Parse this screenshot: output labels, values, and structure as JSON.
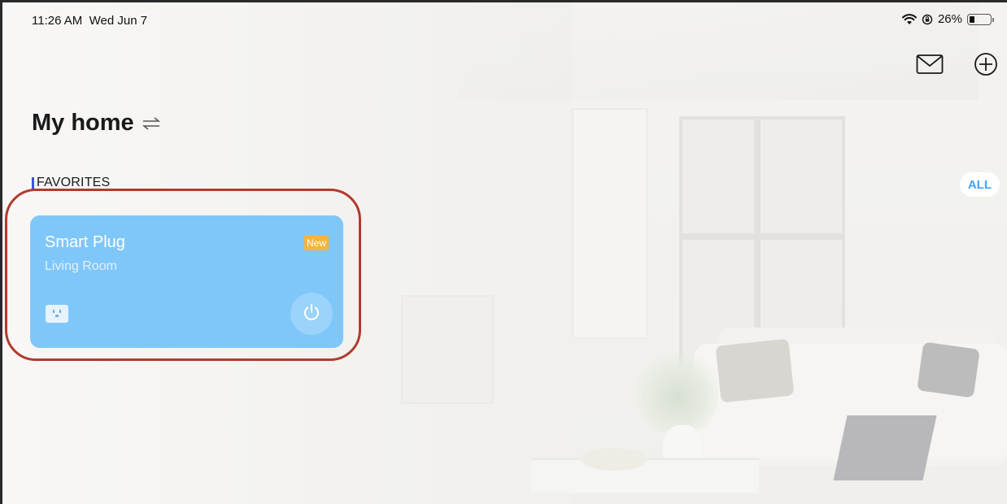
{
  "status_bar": {
    "time": "11:26 AM",
    "date": "Wed Jun 7",
    "battery_percent_label": "26%",
    "battery_level": 0.26,
    "icons": [
      "wifi-icon",
      "lock-rotation-icon",
      "battery-icon"
    ]
  },
  "top_actions": {
    "icons": [
      "mail-icon",
      "add-icon"
    ]
  },
  "home": {
    "title": "My home",
    "switch_icon": "switch-arrows-icon"
  },
  "favorites": {
    "section_label": "FAVORITES",
    "all_label": "ALL",
    "accent_color": "#3d52e3",
    "devices": [
      {
        "name": "Smart Plug",
        "room": "Living Room",
        "badge": "New",
        "icon": "smart-plug-icon",
        "power_icon": "power-icon",
        "card_color": "#7fc7f9",
        "badge_color": "#f3b53a"
      }
    ]
  },
  "annotation": {
    "highlight_color": "#b23a2e"
  }
}
